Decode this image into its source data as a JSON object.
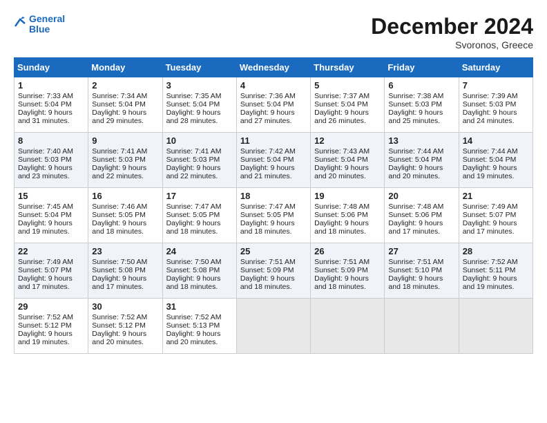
{
  "header": {
    "logo_line1": "General",
    "logo_line2": "Blue",
    "month_title": "December 2024",
    "location": "Svoronos, Greece"
  },
  "weekdays": [
    "Sunday",
    "Monday",
    "Tuesday",
    "Wednesday",
    "Thursday",
    "Friday",
    "Saturday"
  ],
  "weeks": [
    [
      {
        "day": "1",
        "sunrise": "Sunrise: 7:33 AM",
        "sunset": "Sunset: 5:04 PM",
        "daylight": "Daylight: 9 hours and 31 minutes."
      },
      {
        "day": "2",
        "sunrise": "Sunrise: 7:34 AM",
        "sunset": "Sunset: 5:04 PM",
        "daylight": "Daylight: 9 hours and 29 minutes."
      },
      {
        "day": "3",
        "sunrise": "Sunrise: 7:35 AM",
        "sunset": "Sunset: 5:04 PM",
        "daylight": "Daylight: 9 hours and 28 minutes."
      },
      {
        "day": "4",
        "sunrise": "Sunrise: 7:36 AM",
        "sunset": "Sunset: 5:04 PM",
        "daylight": "Daylight: 9 hours and 27 minutes."
      },
      {
        "day": "5",
        "sunrise": "Sunrise: 7:37 AM",
        "sunset": "Sunset: 5:04 PM",
        "daylight": "Daylight: 9 hours and 26 minutes."
      },
      {
        "day": "6",
        "sunrise": "Sunrise: 7:38 AM",
        "sunset": "Sunset: 5:03 PM",
        "daylight": "Daylight: 9 hours and 25 minutes."
      },
      {
        "day": "7",
        "sunrise": "Sunrise: 7:39 AM",
        "sunset": "Sunset: 5:03 PM",
        "daylight": "Daylight: 9 hours and 24 minutes."
      }
    ],
    [
      {
        "day": "8",
        "sunrise": "Sunrise: 7:40 AM",
        "sunset": "Sunset: 5:03 PM",
        "daylight": "Daylight: 9 hours and 23 minutes."
      },
      {
        "day": "9",
        "sunrise": "Sunrise: 7:41 AM",
        "sunset": "Sunset: 5:03 PM",
        "daylight": "Daylight: 9 hours and 22 minutes."
      },
      {
        "day": "10",
        "sunrise": "Sunrise: 7:41 AM",
        "sunset": "Sunset: 5:03 PM",
        "daylight": "Daylight: 9 hours and 22 minutes."
      },
      {
        "day": "11",
        "sunrise": "Sunrise: 7:42 AM",
        "sunset": "Sunset: 5:04 PM",
        "daylight": "Daylight: 9 hours and 21 minutes."
      },
      {
        "day": "12",
        "sunrise": "Sunrise: 7:43 AM",
        "sunset": "Sunset: 5:04 PM",
        "daylight": "Daylight: 9 hours and 20 minutes."
      },
      {
        "day": "13",
        "sunrise": "Sunrise: 7:44 AM",
        "sunset": "Sunset: 5:04 PM",
        "daylight": "Daylight: 9 hours and 20 minutes."
      },
      {
        "day": "14",
        "sunrise": "Sunrise: 7:44 AM",
        "sunset": "Sunset: 5:04 PM",
        "daylight": "Daylight: 9 hours and 19 minutes."
      }
    ],
    [
      {
        "day": "15",
        "sunrise": "Sunrise: 7:45 AM",
        "sunset": "Sunset: 5:04 PM",
        "daylight": "Daylight: 9 hours and 19 minutes."
      },
      {
        "day": "16",
        "sunrise": "Sunrise: 7:46 AM",
        "sunset": "Sunset: 5:05 PM",
        "daylight": "Daylight: 9 hours and 18 minutes."
      },
      {
        "day": "17",
        "sunrise": "Sunrise: 7:47 AM",
        "sunset": "Sunset: 5:05 PM",
        "daylight": "Daylight: 9 hours and 18 minutes."
      },
      {
        "day": "18",
        "sunrise": "Sunrise: 7:47 AM",
        "sunset": "Sunset: 5:05 PM",
        "daylight": "Daylight: 9 hours and 18 minutes."
      },
      {
        "day": "19",
        "sunrise": "Sunrise: 7:48 AM",
        "sunset": "Sunset: 5:06 PM",
        "daylight": "Daylight: 9 hours and 18 minutes."
      },
      {
        "day": "20",
        "sunrise": "Sunrise: 7:48 AM",
        "sunset": "Sunset: 5:06 PM",
        "daylight": "Daylight: 9 hours and 17 minutes."
      },
      {
        "day": "21",
        "sunrise": "Sunrise: 7:49 AM",
        "sunset": "Sunset: 5:07 PM",
        "daylight": "Daylight: 9 hours and 17 minutes."
      }
    ],
    [
      {
        "day": "22",
        "sunrise": "Sunrise: 7:49 AM",
        "sunset": "Sunset: 5:07 PM",
        "daylight": "Daylight: 9 hours and 17 minutes."
      },
      {
        "day": "23",
        "sunrise": "Sunrise: 7:50 AM",
        "sunset": "Sunset: 5:08 PM",
        "daylight": "Daylight: 9 hours and 17 minutes."
      },
      {
        "day": "24",
        "sunrise": "Sunrise: 7:50 AM",
        "sunset": "Sunset: 5:08 PM",
        "daylight": "Daylight: 9 hours and 18 minutes."
      },
      {
        "day": "25",
        "sunrise": "Sunrise: 7:51 AM",
        "sunset": "Sunset: 5:09 PM",
        "daylight": "Daylight: 9 hours and 18 minutes."
      },
      {
        "day": "26",
        "sunrise": "Sunrise: 7:51 AM",
        "sunset": "Sunset: 5:09 PM",
        "daylight": "Daylight: 9 hours and 18 minutes."
      },
      {
        "day": "27",
        "sunrise": "Sunrise: 7:51 AM",
        "sunset": "Sunset: 5:10 PM",
        "daylight": "Daylight: 9 hours and 18 minutes."
      },
      {
        "day": "28",
        "sunrise": "Sunrise: 7:52 AM",
        "sunset": "Sunset: 5:11 PM",
        "daylight": "Daylight: 9 hours and 19 minutes."
      }
    ],
    [
      {
        "day": "29",
        "sunrise": "Sunrise: 7:52 AM",
        "sunset": "Sunset: 5:12 PM",
        "daylight": "Daylight: 9 hours and 19 minutes."
      },
      {
        "day": "30",
        "sunrise": "Sunrise: 7:52 AM",
        "sunset": "Sunset: 5:12 PM",
        "daylight": "Daylight: 9 hours and 20 minutes."
      },
      {
        "day": "31",
        "sunrise": "Sunrise: 7:52 AM",
        "sunset": "Sunset: 5:13 PM",
        "daylight": "Daylight: 9 hours and 20 minutes."
      },
      null,
      null,
      null,
      null
    ]
  ]
}
